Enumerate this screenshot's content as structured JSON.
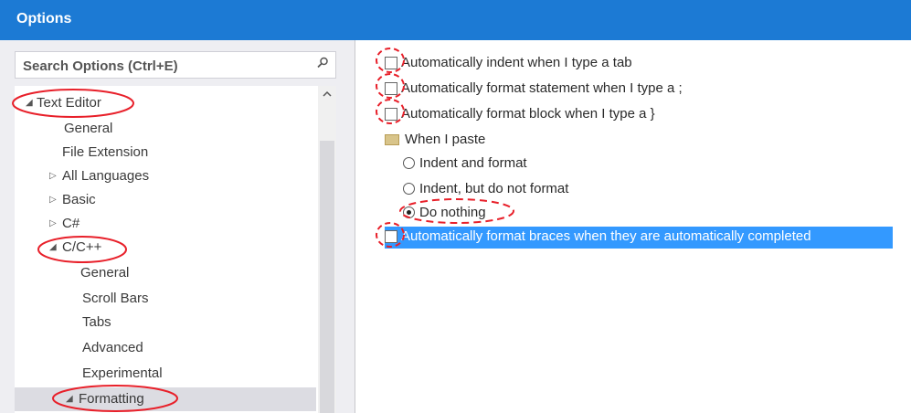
{
  "window": {
    "title": "Options"
  },
  "search": {
    "placeholder": "Search Options (Ctrl+E)"
  },
  "tree": {
    "items": [
      {
        "label": "Text Editor",
        "expander": "◢",
        "expanded": true
      },
      {
        "label": "General"
      },
      {
        "label": "File Extension"
      },
      {
        "label": "All Languages",
        "expander": "▷"
      },
      {
        "label": "Basic",
        "expander": "▷"
      },
      {
        "label": "C#",
        "expander": "▷"
      },
      {
        "label": "C/C++",
        "expander": "◢",
        "expanded": true
      },
      {
        "label": "General"
      },
      {
        "label": "Scroll Bars"
      },
      {
        "label": "Tabs"
      },
      {
        "label": "Advanced"
      },
      {
        "label": "Experimental"
      },
      {
        "label": "Formatting",
        "expander": "◢",
        "selected": true
      }
    ]
  },
  "options": {
    "indent_tab": {
      "label": "Automatically indent when I type a tab",
      "checked": false
    },
    "format_statement": {
      "label": "Automatically format statement when I type a ;",
      "checked": false
    },
    "format_block": {
      "label": "Automatically format block when I type a }",
      "checked": false
    },
    "paste_group": {
      "label": "When I paste"
    },
    "paste_options": [
      {
        "label": "Indent and format",
        "selected": false
      },
      {
        "label": "Indent, but do not format",
        "selected": false
      },
      {
        "label": "Do nothing",
        "selected": true
      }
    ],
    "format_braces": {
      "label": "Automatically format braces when they are automatically completed",
      "checked": false,
      "highlighted": true
    }
  },
  "colors": {
    "titlebar": "#1c7ad4",
    "highlight": "#3399ff",
    "annotation": "#e8202a"
  }
}
